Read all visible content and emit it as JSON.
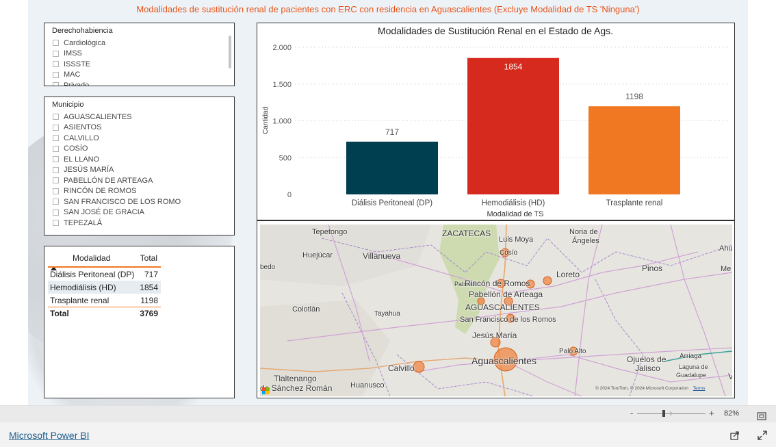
{
  "report_title": "Modalidades de sustitución renal de pacientes con ERC con residencia en Aguascalientes (Excluye Modalidad de TS 'Ninguna')",
  "slicer_derecho": {
    "title": "Derechohabiencia",
    "items": [
      "Cardiológica",
      "IMSS",
      "ISSSTE",
      "MAC",
      "Privado"
    ]
  },
  "slicer_municipio": {
    "title": "Municipio",
    "items": [
      "AGUASCALIENTES",
      "ASIENTOS",
      "CALVILLO",
      "COSÍO",
      "EL LLANO",
      "JESÚS MARÍA",
      "PABELLÓN DE ARTEAGA",
      "RINCÓN DE ROMOS",
      "SAN FRANCISCO DE LOS ROMO",
      "SAN JOSÉ DE GRACIA",
      "TEPEZALÁ"
    ]
  },
  "table": {
    "headers": [
      "Modalidad",
      "Total"
    ],
    "rows": [
      {
        "modalidad": "Diálisis Peritoneal (DP)",
        "total": "717"
      },
      {
        "modalidad": "Hemodiálisis (HD)",
        "total": "1854"
      },
      {
        "modalidad": "Trasplante renal",
        "total": "1198"
      }
    ],
    "total_label": "Total",
    "total_value": "3769"
  },
  "chart_data": {
    "type": "bar",
    "title": "Modalidades de Sustitución Renal en el Estado de Ags.",
    "xlabel": "Modalidad de TS",
    "ylabel": "Cantidad",
    "categories": [
      "Diálisis Peritoneal (DP)",
      "Hemodiálisis (HD)",
      "Trasplante renal"
    ],
    "values": [
      717,
      1854,
      1198
    ],
    "colors": [
      "#003f4f",
      "#d62a1e",
      "#f07823"
    ],
    "ylim": [
      0,
      2000
    ],
    "yticks": [
      0,
      500,
      1000,
      1500,
      2000
    ],
    "ytick_labels": [
      "0",
      "500",
      "1.000",
      "1.500",
      "2.000"
    ],
    "grid": true
  },
  "map": {
    "labels": [
      "Tepetongo",
      "ZACATECAS",
      "Luis Moya",
      "Noria de",
      "Ángeles",
      "Huejúcar",
      "Villanueva",
      "Cosío",
      "Loreto",
      "Pinos",
      "Ahu",
      "Me",
      "bedo",
      "Pabellón",
      "Rincón de Romos",
      "Pabellón de Arteaga",
      "AGUASCALIENTES",
      "Colotlán",
      "Tayahua",
      "San Francisco de los Romos",
      "Jesús María",
      "Aguascalientes",
      "Palo Alto",
      "Ojuelos de",
      "Jalisco",
      "Arriaga",
      "Laguna de",
      "Guadalupe",
      "Calvillo",
      "Tlaltenango",
      "de Sánchez Román",
      "Huanusco",
      "V"
    ],
    "copyright": "© 2024 TomTom, © 2024 Microsoft Corporation",
    "terms": "Terms"
  },
  "footer": {
    "brand": "Microsoft Power BI",
    "zoom": "82%",
    "zoom_minus": "-",
    "zoom_plus": "+"
  }
}
